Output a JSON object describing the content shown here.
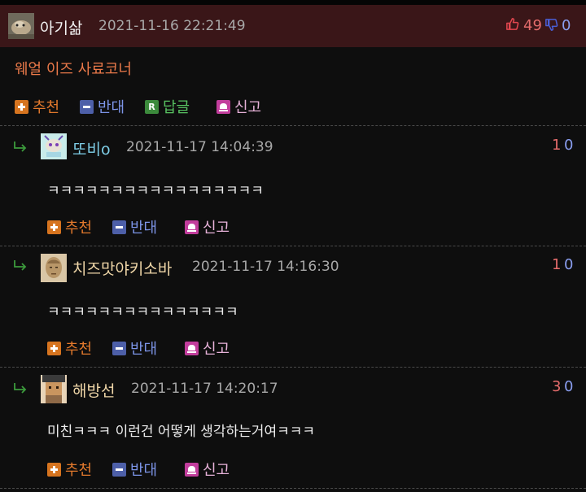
{
  "colors": {
    "background": "#0e0e0e",
    "post_header_bg": "#3a1618",
    "upvote": "#e2792c",
    "downvote": "#7d95e8",
    "reply": "#58c261",
    "report": "#e7b2d9",
    "title": "#ec7a4a"
  },
  "post": {
    "author": "아기삶",
    "timestamp": "2021-11-16 22:21:49",
    "likes": "49",
    "dislikes": "0",
    "title": "웨얼 이즈 사료코너",
    "actions": {
      "upvote": "추천",
      "downvote": "반대",
      "reply_icon": "R",
      "reply": "답글",
      "report": "신고"
    }
  },
  "comments": [
    {
      "author": "또비o",
      "timestamp": "2021-11-17 14:04:39",
      "up": "1",
      "down": "0",
      "text": "ㅋㅋㅋㅋㅋㅋㅋㅋㅋㅋㅋㅋㅋㅋㅋㅋㅋ",
      "upvote": "추천",
      "downvote": "반대",
      "report": "신고"
    },
    {
      "author": "치즈맛야키소바",
      "timestamp": "2021-11-17 14:16:30",
      "up": "1",
      "down": "0",
      "text": "ㅋㅋㅋㅋㅋㅋㅋㅋㅋㅋㅋㅋㅋㅋㅋ",
      "upvote": "추천",
      "downvote": "반대",
      "report": "신고"
    },
    {
      "author": "해방선",
      "timestamp": "2021-11-17 14:20:17",
      "up": "3",
      "down": "0",
      "text": "미친ㅋㅋㅋ 이런건 어떻게 생각하는거여ㅋㅋㅋ",
      "upvote": "추천",
      "downvote": "반대",
      "report": "신고"
    }
  ]
}
